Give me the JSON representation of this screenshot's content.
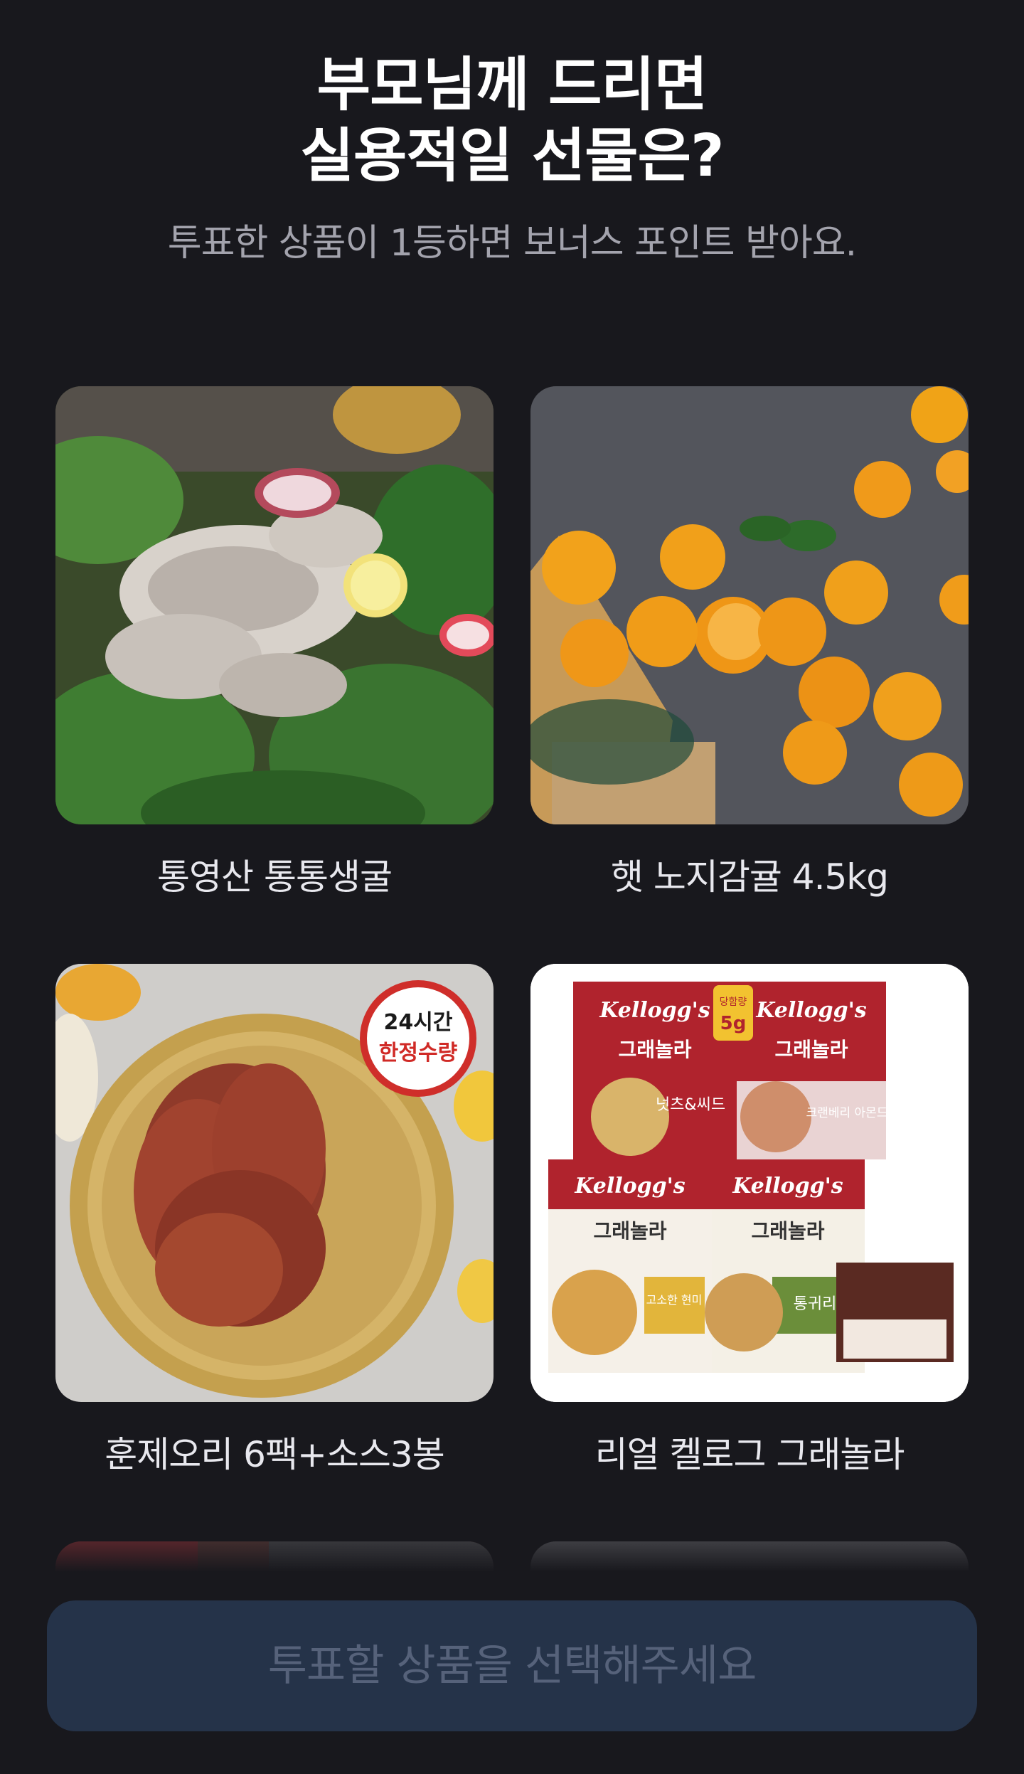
{
  "header": {
    "title_line1": "부모님께 드리면",
    "title_line2": "실용적일 선물은?",
    "subtitle": "투표한 상품이 1등하면 보너스 포인트 받아요."
  },
  "products": [
    {
      "name": "통영산 통통생굴",
      "image": "oyster-salad"
    },
    {
      "name": "햇 노지감귤 4.5kg",
      "image": "tangerines"
    },
    {
      "name": "훈제오리 6팩+소스3봉",
      "image": "smoked-duck",
      "badge_line1": "24시간",
      "badge_line2": "한정수량"
    },
    {
      "name": "리얼 켈로그 그래놀라",
      "image": "kelloggs-granola",
      "brand": "Kellogg's",
      "package_title": "그래놀라",
      "flavors": [
        "넛츠&씨드",
        "크랜베리 아몬드",
        "고소한 현미",
        "통귀리"
      ],
      "sugar_tag_label": "당함량",
      "sugar_tag_value": "5g"
    }
  ],
  "cta": {
    "label": "투표할 상품을 선택해주세요"
  },
  "colors": {
    "background": "#18181d",
    "cta_background": "#253349",
    "cta_text": "#56627a",
    "subtitle": "#a3a3ad"
  }
}
